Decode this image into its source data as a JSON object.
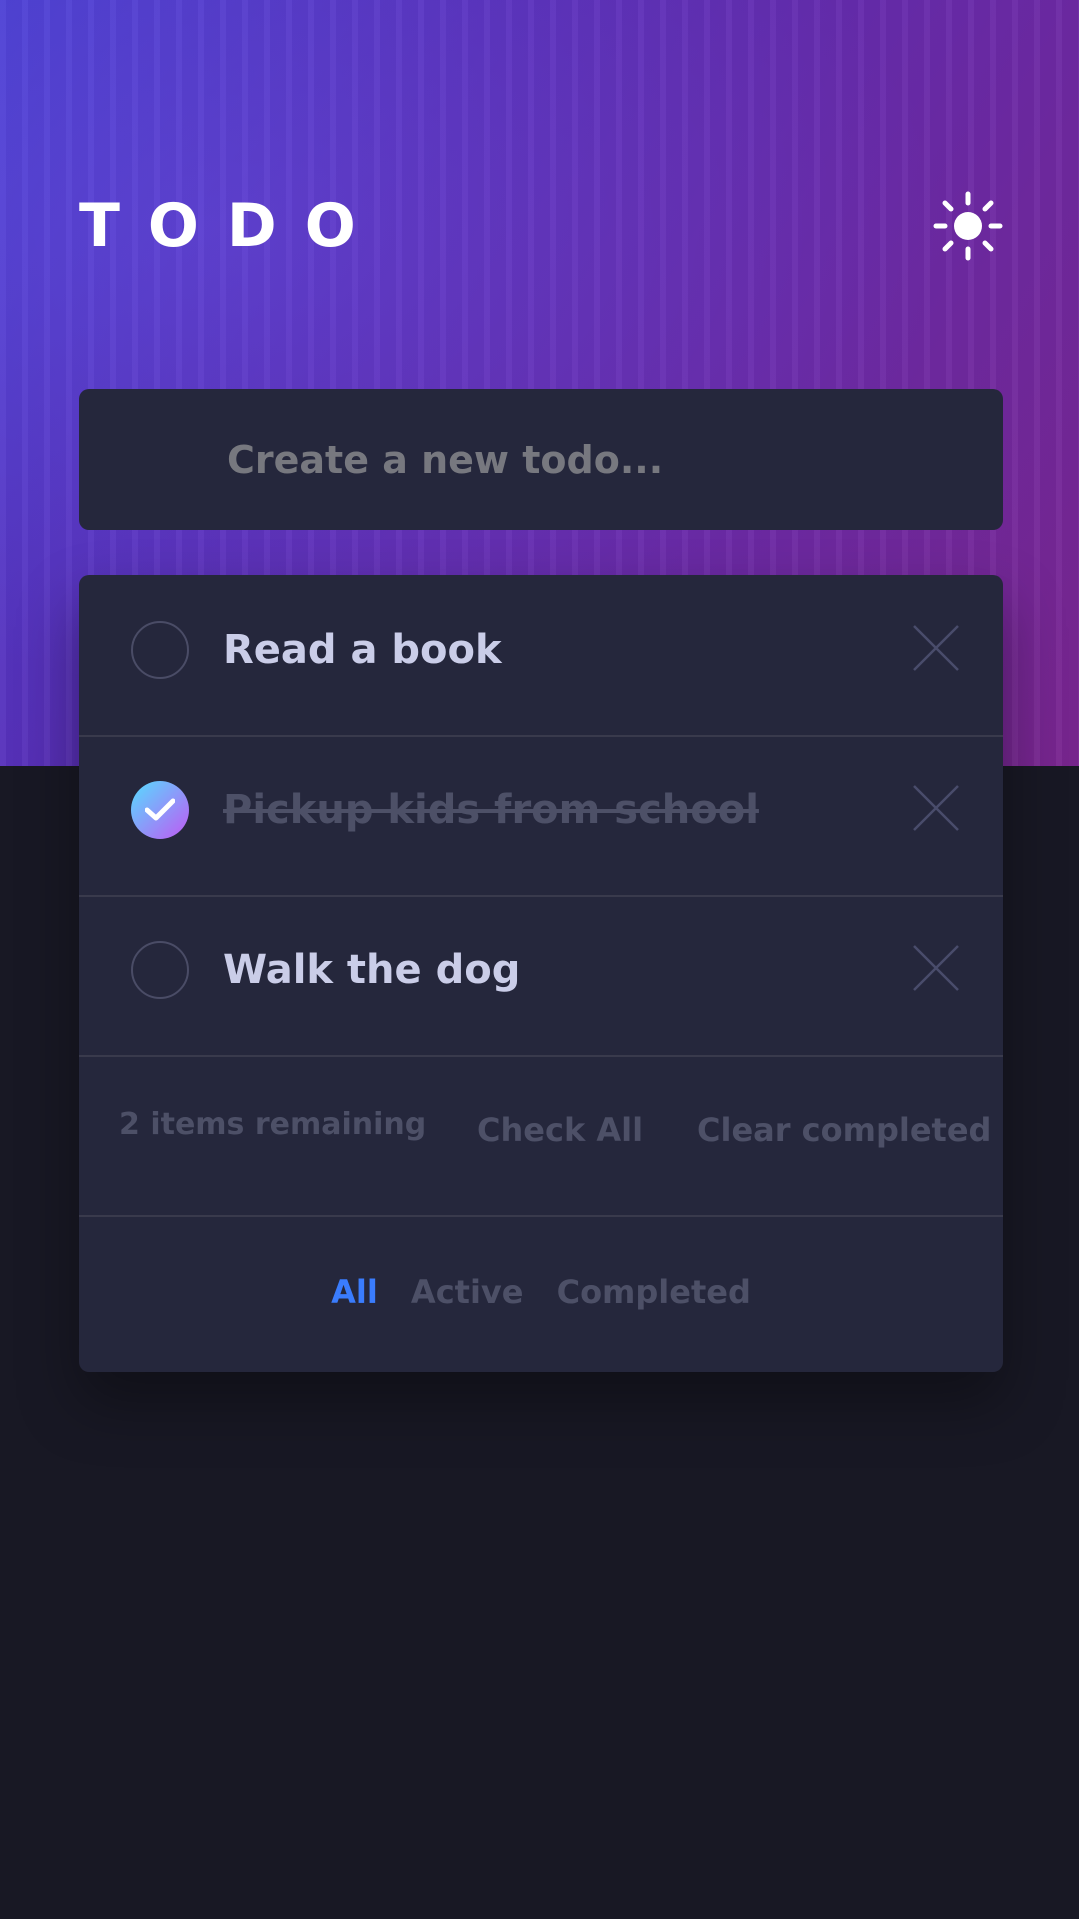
{
  "header": {
    "title": "TODO",
    "theme_toggle_icon": "sun-icon"
  },
  "new_todo": {
    "placeholder": "Create a new todo...",
    "value": ""
  },
  "todos": [
    {
      "label": "Read a book",
      "completed": false
    },
    {
      "label": "Pickup kids from school",
      "completed": true
    },
    {
      "label": "Walk the dog",
      "completed": false
    }
  ],
  "footer": {
    "remaining": "2 items remaining",
    "check_all": "Check All",
    "clear_completed": "Clear completed"
  },
  "filters": {
    "all": "All",
    "active": "Active",
    "completed": "Completed",
    "selected": "All"
  },
  "colors": {
    "accent": "#3a7cfd",
    "card": "#25273c",
    "background": "#181824",
    "check_gradient_start": "#55ddff",
    "check_gradient_end": "#c058f3"
  }
}
